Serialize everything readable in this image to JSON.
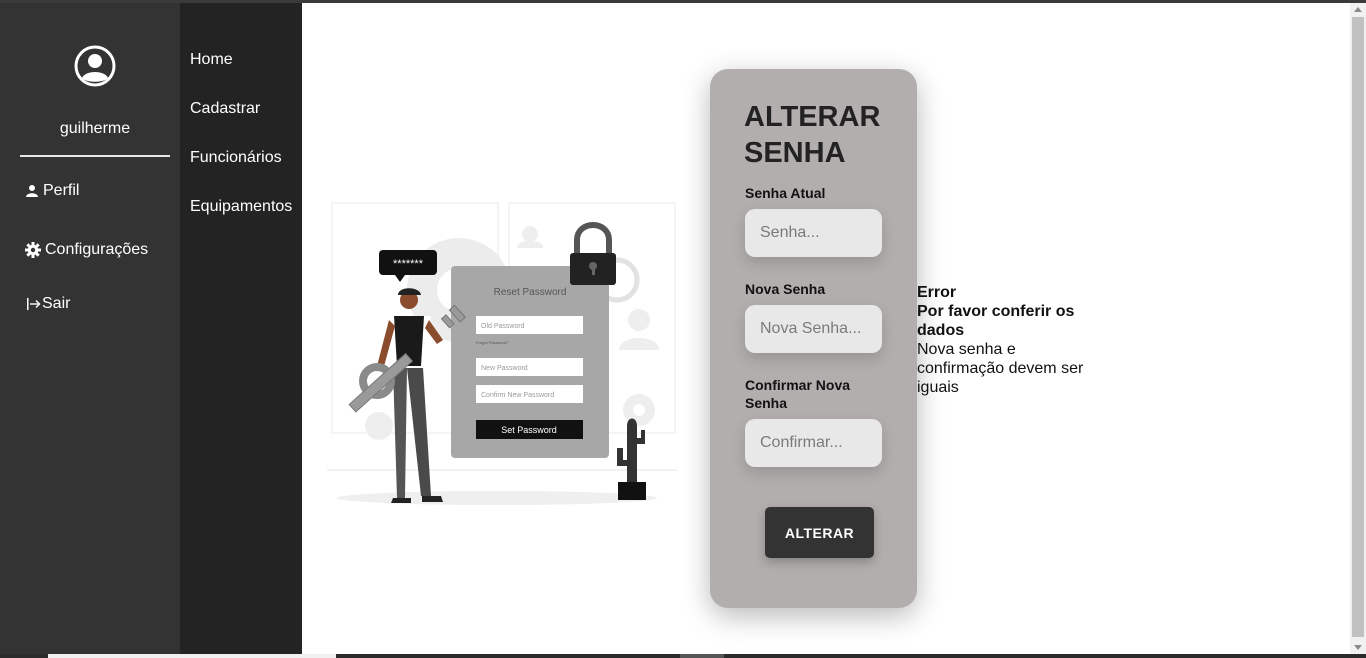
{
  "sidebar": {
    "username": "guilherme",
    "links": [
      {
        "label": "Perfil",
        "icon": "person-icon"
      },
      {
        "label": "Configurações",
        "icon": "gear-icon"
      },
      {
        "label": "Sair",
        "icon": "logout-icon"
      }
    ]
  },
  "nav": {
    "items": [
      "Home",
      "Cadastrar",
      "Funcionários",
      "Equipamentos"
    ]
  },
  "illustration": {
    "password_bubble": "*******",
    "form_title": "Reset Password",
    "old_password": "Old Password",
    "forgot_password": "Forgot Password?",
    "new_password": "New Password",
    "confirm_password": "Confirm New Password",
    "set_button": "Set Password"
  },
  "form": {
    "title_line1": "ALTERAR",
    "title_line2": "SENHA",
    "current_label": "Senha Atual",
    "current_placeholder": "Senha...",
    "new_label": "Nova Senha",
    "new_placeholder": "Nova Senha...",
    "confirm_label": "Confirmar Nova Senha",
    "confirm_placeholder": "Confirmar...",
    "submit_label": "ALTERAR"
  },
  "error": {
    "title": "Error",
    "heading": "Por favor conferir os dados",
    "message": "Nova senha e confirmação devem ser iguais"
  },
  "colors": {
    "sidebar": "#333333",
    "nav": "#232323",
    "card": "#b2aeae",
    "button": "#333333"
  }
}
